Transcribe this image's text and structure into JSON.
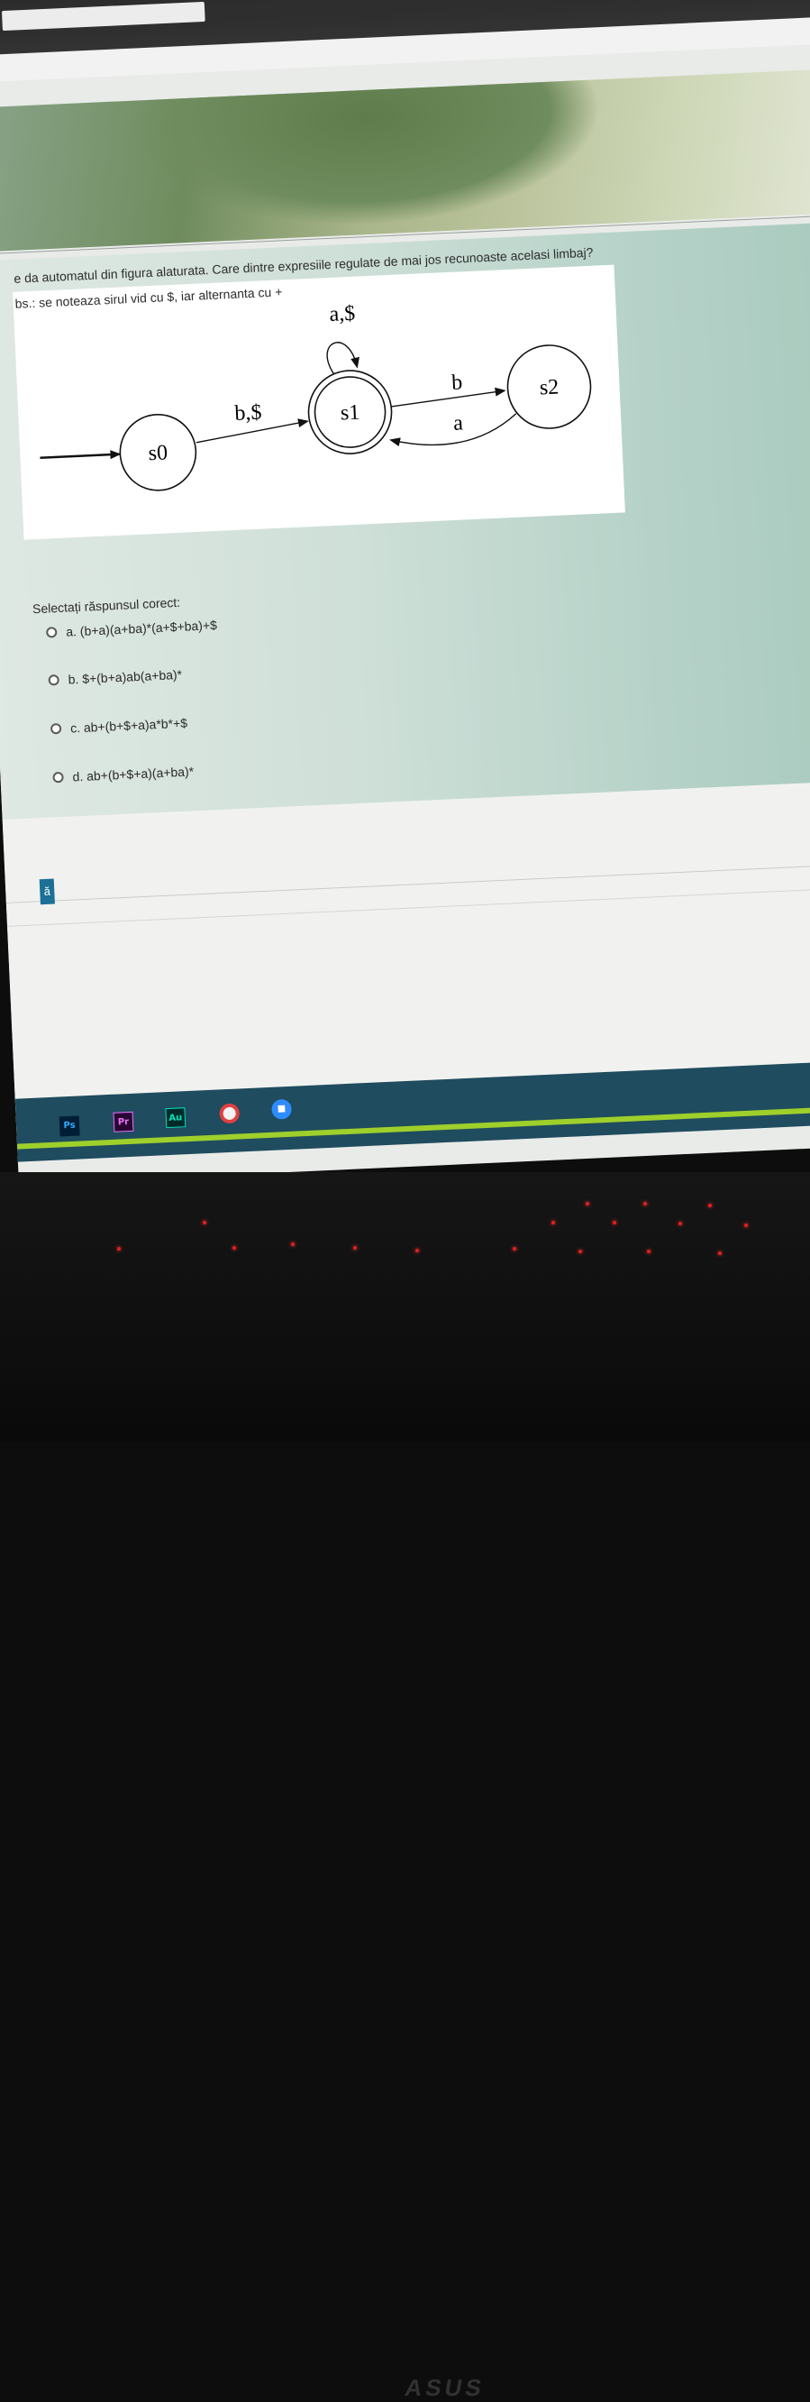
{
  "question": {
    "text": "e da automatul din figura alaturata. Care dintre expresiile regulate de mai jos recunoaste acelasi limbaj?",
    "obs": "bs.: se noteaza sirul vid cu $, iar alternanta cu +"
  },
  "diagram": {
    "states": [
      "s0",
      "s1",
      "s2"
    ],
    "edge_labels": {
      "self_loop_s1": "a,$",
      "s0_to_s1": "b,$",
      "s1_to_s2": "b",
      "s2_to_s1": "a"
    }
  },
  "answers": {
    "prompt": "Selectați răspunsul corect:",
    "options": [
      {
        "text": "a. (b+a)(a+ba)*(a+$+ba)+$"
      },
      {
        "text": "b. $+(b+a)ab(a+ba)*"
      },
      {
        "text": "c. ab+(b+$+a)a*b*+$"
      },
      {
        "text": "d. ab+(b+$+a)(a+ba)*"
      }
    ]
  },
  "side_button": "ă",
  "taskbar": {
    "apps": [
      {
        "name": "photoshop",
        "label": "Ps",
        "color": "#31a8ff"
      },
      {
        "name": "premiere",
        "label": "Pr",
        "color": "#ea77ff"
      },
      {
        "name": "audition",
        "label": "Au",
        "color": "#00e4bb"
      },
      {
        "name": "webcam",
        "label": "",
        "color": "#e04040"
      },
      {
        "name": "zoom",
        "label": "",
        "color": "#2d8cff"
      }
    ]
  },
  "laptop_logo": "ASUS"
}
